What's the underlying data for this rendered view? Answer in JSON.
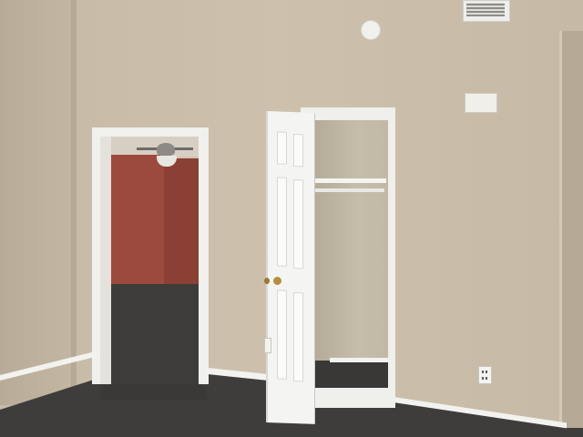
{
  "scene": {
    "colors": {
      "wall": "#c8bca8",
      "accent_wall": "#9c4a3d",
      "carpet": "#3e3c3a",
      "trim": "#f0f0ed"
    },
    "objects": {
      "doorway": "open-doorway",
      "closet": "open-closet",
      "door": "six-panel-door",
      "ceiling_fan": "ceiling-fan-icon",
      "vent": "air-vent-icon",
      "smoke_detector": "smoke-detector-icon",
      "thermostat": "thermostat-icon",
      "outlet": "power-outlet-icon"
    }
  }
}
